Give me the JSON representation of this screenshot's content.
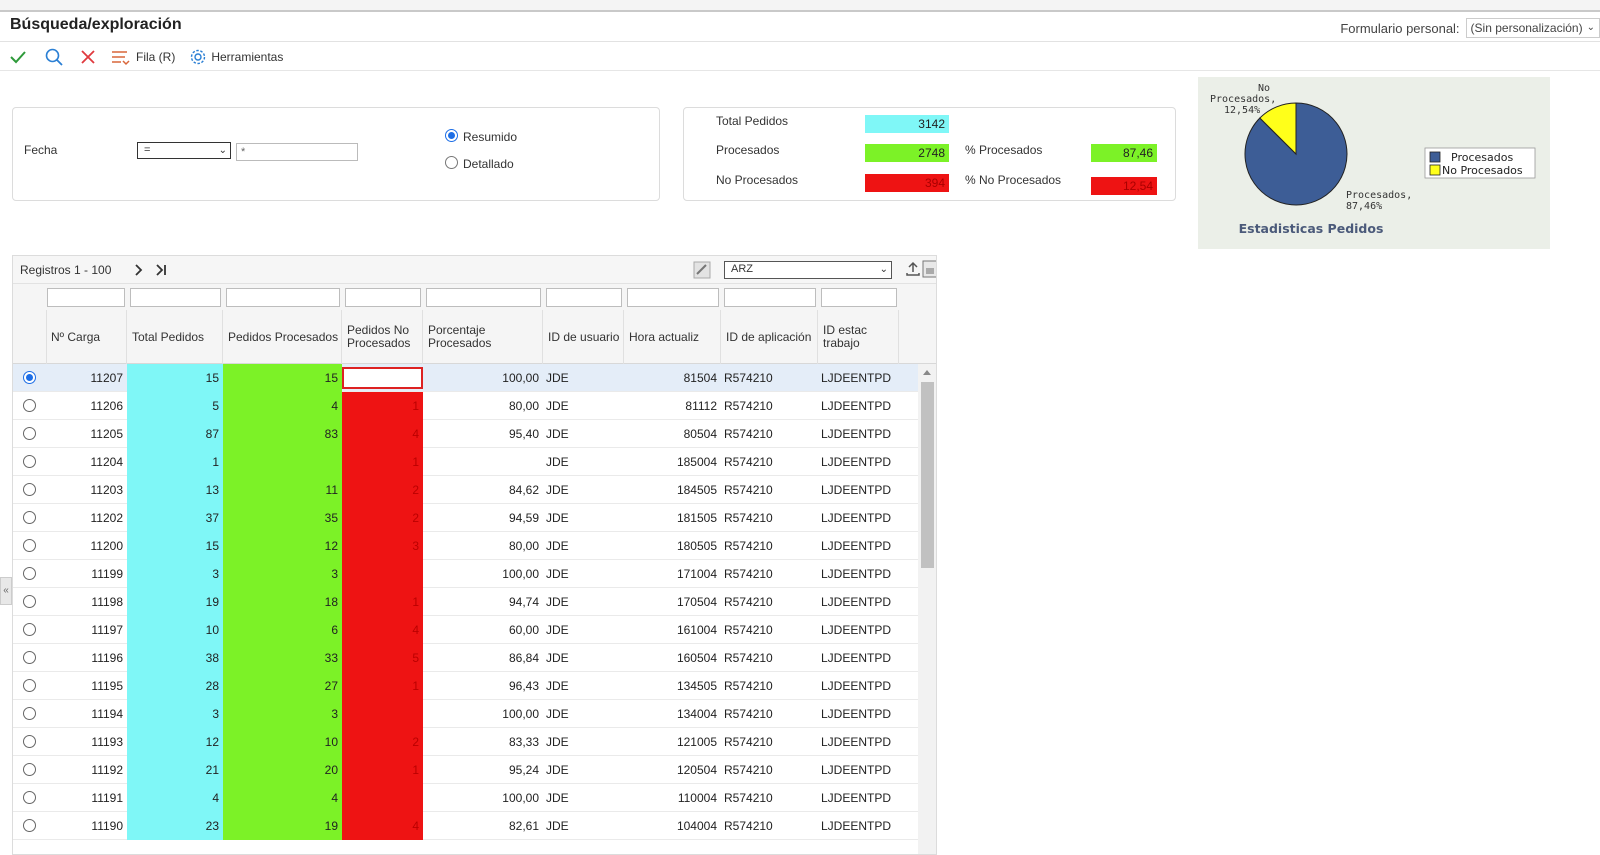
{
  "header": {
    "title": "Búsqueda/exploración",
    "personal_label": "Formulario personal:",
    "personal_value": "(Sin personalización)"
  },
  "toolbar": {
    "row_label": "Fila (R)",
    "tools_label": "Herramientas"
  },
  "filter": {
    "fecha_label": "Fecha",
    "operator": "=",
    "value": "*",
    "mode_summary": "Resumido",
    "mode_detail": "Detallado",
    "selected_mode": "Resumido"
  },
  "stats": {
    "total_label": "Total Pedidos",
    "total_value": "3142",
    "processed_label": "Procesados",
    "processed_value": "2748",
    "not_processed_label": "No Procesados",
    "not_processed_value": "394",
    "pct_processed_label": "% Procesados",
    "pct_processed_value": "87,46",
    "pct_not_processed_label": "% No Procesados",
    "pct_not_processed_value": "12,54"
  },
  "chart_data": {
    "type": "pie",
    "title": "Estadisticas Pedidos",
    "categories": [
      "Procesados",
      "No Procesados"
    ],
    "values": [
      87.46,
      12.54
    ],
    "slice_labels": [
      "Procesados, 87,46%",
      "No Procesados, 12,54%"
    ],
    "colors": [
      "#3d5d96",
      "#ffff1a"
    ],
    "legend": [
      "Procesados",
      "No Procesados"
    ],
    "legend_position": "right"
  },
  "grid": {
    "records_label": "Registros 1 - 100",
    "view_select": "ARZ",
    "columns": [
      "Nº Carga",
      "Total Pedidos",
      "Pedidos Procesados",
      "Pedidos No Procesados",
      "Porcentaje Procesados",
      "ID de usuario",
      "Hora actualiz",
      "ID de aplicación",
      "ID estac trabajo"
    ],
    "rows": [
      {
        "carga": "11207",
        "total": "15",
        "proc": "15",
        "noproc": "",
        "pct": "100,00",
        "user": "JDE",
        "hora": "81504",
        "app": "R574210",
        "estac": "LJDEENTPD"
      },
      {
        "carga": "11206",
        "total": "5",
        "proc": "4",
        "noproc": "1",
        "pct": "80,00",
        "user": "JDE",
        "hora": "81112",
        "app": "R574210",
        "estac": "LJDEENTPD"
      },
      {
        "carga": "11205",
        "total": "87",
        "proc": "83",
        "noproc": "4",
        "pct": "95,40",
        "user": "JDE",
        "hora": "80504",
        "app": "R574210",
        "estac": "LJDEENTPD"
      },
      {
        "carga": "11204",
        "total": "1",
        "proc": "",
        "noproc": "1",
        "pct": "",
        "user": "JDE",
        "hora": "185004",
        "app": "R574210",
        "estac": "LJDEENTPD"
      },
      {
        "carga": "11203",
        "total": "13",
        "proc": "11",
        "noproc": "2",
        "pct": "84,62",
        "user": "JDE",
        "hora": "184505",
        "app": "R574210",
        "estac": "LJDEENTPD"
      },
      {
        "carga": "11202",
        "total": "37",
        "proc": "35",
        "noproc": "2",
        "pct": "94,59",
        "user": "JDE",
        "hora": "181505",
        "app": "R574210",
        "estac": "LJDEENTPD"
      },
      {
        "carga": "11200",
        "total": "15",
        "proc": "12",
        "noproc": "3",
        "pct": "80,00",
        "user": "JDE",
        "hora": "180505",
        "app": "R574210",
        "estac": "LJDEENTPD"
      },
      {
        "carga": "11199",
        "total": "3",
        "proc": "3",
        "noproc": "",
        "pct": "100,00",
        "user": "JDE",
        "hora": "171004",
        "app": "R574210",
        "estac": "LJDEENTPD"
      },
      {
        "carga": "11198",
        "total": "19",
        "proc": "18",
        "noproc": "1",
        "pct": "94,74",
        "user": "JDE",
        "hora": "170504",
        "app": "R574210",
        "estac": "LJDEENTPD"
      },
      {
        "carga": "11197",
        "total": "10",
        "proc": "6",
        "noproc": "4",
        "pct": "60,00",
        "user": "JDE",
        "hora": "161004",
        "app": "R574210",
        "estac": "LJDEENTPD"
      },
      {
        "carga": "11196",
        "total": "38",
        "proc": "33",
        "noproc": "5",
        "pct": "86,84",
        "user": "JDE",
        "hora": "160504",
        "app": "R574210",
        "estac": "LJDEENTPD"
      },
      {
        "carga": "11195",
        "total": "28",
        "proc": "27",
        "noproc": "1",
        "pct": "96,43",
        "user": "JDE",
        "hora": "134505",
        "app": "R574210",
        "estac": "LJDEENTPD"
      },
      {
        "carga": "11194",
        "total": "3",
        "proc": "3",
        "noproc": "",
        "pct": "100,00",
        "user": "JDE",
        "hora": "134004",
        "app": "R574210",
        "estac": "LJDEENTPD"
      },
      {
        "carga": "11193",
        "total": "12",
        "proc": "10",
        "noproc": "2",
        "pct": "83,33",
        "user": "JDE",
        "hora": "121005",
        "app": "R574210",
        "estac": "LJDEENTPD"
      },
      {
        "carga": "11192",
        "total": "21",
        "proc": "20",
        "noproc": "1",
        "pct": "95,24",
        "user": "JDE",
        "hora": "120504",
        "app": "R574210",
        "estac": "LJDEENTPD"
      },
      {
        "carga": "11191",
        "total": "4",
        "proc": "4",
        "noproc": "",
        "pct": "100,00",
        "user": "JDE",
        "hora": "110004",
        "app": "R574210",
        "estac": "LJDEENTPD"
      },
      {
        "carga": "11190",
        "total": "23",
        "proc": "19",
        "noproc": "4",
        "pct": "82,61",
        "user": "JDE",
        "hora": "104004",
        "app": "R574210",
        "estac": "LJDEENTPD"
      }
    ]
  }
}
